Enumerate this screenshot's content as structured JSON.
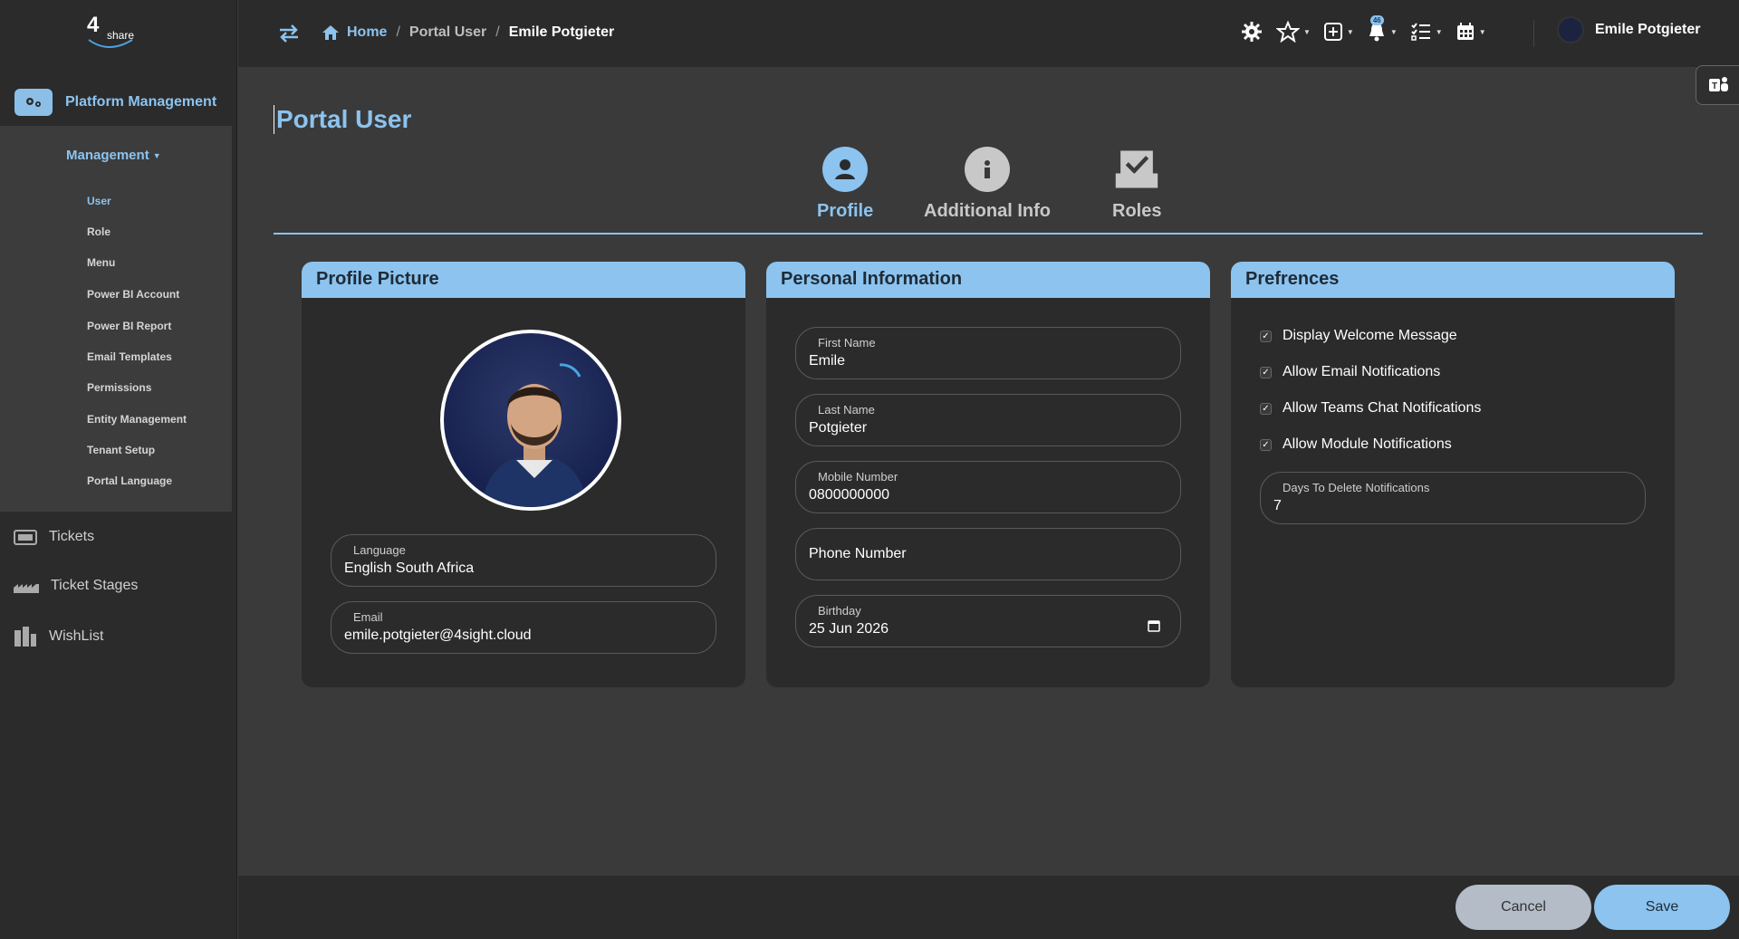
{
  "sidebar": {
    "logo_text": "share",
    "platform_label": "Platform Management",
    "management_label": "Management",
    "sub_items": [
      {
        "label": "User",
        "active": true
      },
      {
        "label": "Role"
      },
      {
        "label": "Menu"
      },
      {
        "label": "Power BI Account"
      },
      {
        "label": "Power BI Report"
      },
      {
        "label": "Email Templates"
      },
      {
        "label": "Permissions"
      },
      {
        "label": "Entity Management"
      },
      {
        "label": "Tenant Setup"
      },
      {
        "label": "Portal Language"
      }
    ],
    "items": [
      {
        "label": "Tickets",
        "icon": "ticket-icon"
      },
      {
        "label": "Ticket Stages",
        "icon": "stages-icon"
      },
      {
        "label": "WishList",
        "icon": "wishlist-icon"
      }
    ]
  },
  "topbar": {
    "breadcrumb": {
      "home": "Home",
      "sep": "/",
      "section": "Portal User",
      "current": "Emile Potgieter"
    },
    "notification_count": "46",
    "user_name": "Emile Potgieter"
  },
  "page": {
    "title": "Portal User",
    "steps": [
      {
        "label": "Profile",
        "active": true
      },
      {
        "label": "Additional Info"
      },
      {
        "label": "Roles"
      }
    ]
  },
  "profile_card": {
    "title": "Profile Picture",
    "language_label": "Language",
    "language_value": "English South Africa",
    "email_label": "Email",
    "email_value": "emile.potgieter@4sight.cloud"
  },
  "personal_card": {
    "title": "Personal Information",
    "first_name_label": "First Name",
    "first_name_value": "Emile",
    "last_name_label": "Last Name",
    "last_name_value": "Potgieter",
    "mobile_label": "Mobile Number",
    "mobile_value": "0800000000",
    "phone_placeholder": "Phone Number",
    "birthday_label": "Birthday",
    "birthday_value": "25 Jun 2026"
  },
  "prefs_card": {
    "title": "Prefrences",
    "options": [
      {
        "label": "Display Welcome Message",
        "checked": true
      },
      {
        "label": "Allow Email Notifications",
        "checked": true
      },
      {
        "label": "Allow Teams Chat Notifications",
        "checked": true
      },
      {
        "label": "Allow Module Notifications",
        "checked": true
      }
    ],
    "days_label": "Days To Delete Notifications",
    "days_value": "7"
  },
  "footer": {
    "cancel_label": "Cancel",
    "save_label": "Save"
  },
  "colors": {
    "accent": "#8cc3ef",
    "background": "#3a3a3a",
    "panel": "#2b2b2b"
  }
}
